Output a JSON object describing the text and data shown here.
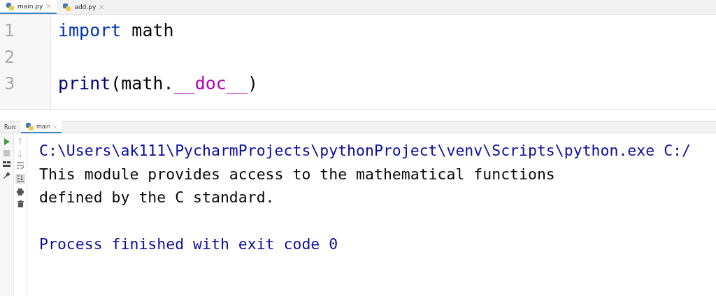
{
  "editor_tabs": [
    {
      "label": "main.py",
      "selected": true,
      "closable": true
    },
    {
      "label": "add.py",
      "selected": false,
      "closable": true
    }
  ],
  "editor": {
    "lines": [
      {
        "number": "1",
        "tokens": [
          {
            "kind": "keyword",
            "text": "import"
          },
          {
            "kind": "plain",
            "text": " math"
          }
        ]
      },
      {
        "number": "2"
      },
      {
        "number": "3",
        "tokens": [
          {
            "kind": "builtin",
            "text": "print"
          },
          {
            "kind": "plain",
            "text": "(math."
          },
          {
            "kind": "magic",
            "text": "__doc__"
          },
          {
            "kind": "plain",
            "text": ")"
          }
        ]
      }
    ]
  },
  "run_panel": {
    "label": "Run:",
    "tab": {
      "label": "main",
      "selected": true
    },
    "scroll_to_end": true,
    "console": [
      {
        "kind": "system",
        "text": "C:\\Users\\ak111\\PycharmProjects\\pythonProject\\venv\\Scripts\\python.exe C:/"
      },
      {
        "kind": "output",
        "text": "This module provides access to the mathematical functions"
      },
      {
        "kind": "output",
        "text": "defined by the C standard."
      },
      {
        "kind": "blank"
      },
      {
        "kind": "system",
        "text": "Process finished with exit code 0"
      }
    ]
  }
}
